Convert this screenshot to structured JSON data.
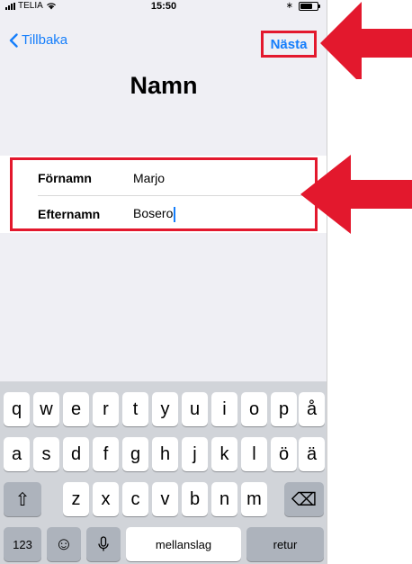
{
  "status_bar": {
    "carrier": "TELIA",
    "time": "15:50",
    "bluetooth": "∗"
  },
  "nav": {
    "back_label": "Tillbaka",
    "next_label": "Nästa"
  },
  "page": {
    "title": "Namn"
  },
  "form": {
    "fields": [
      {
        "label": "Förnamn",
        "value": "Marjo"
      },
      {
        "label": "Efternamn",
        "value": "Bosero"
      }
    ]
  },
  "keyboard": {
    "row1": [
      "q",
      "w",
      "e",
      "r",
      "t",
      "y",
      "u",
      "i",
      "o",
      "p",
      "å"
    ],
    "row2": [
      "a",
      "s",
      "d",
      "f",
      "g",
      "h",
      "j",
      "k",
      "l",
      "ö",
      "ä"
    ],
    "row3": [
      "z",
      "x",
      "c",
      "v",
      "b",
      "n",
      "m"
    ],
    "numbers_label": "123",
    "space_label": "mellanslag",
    "return_label": "retur",
    "shift_icon": "⇧",
    "delete_icon": "⌫",
    "emoji_icon": "☺",
    "mic_icon": "microphone-icon"
  },
  "annotation": {
    "highlight_color": "#e3182d",
    "arrow_color": "#e3182d"
  }
}
